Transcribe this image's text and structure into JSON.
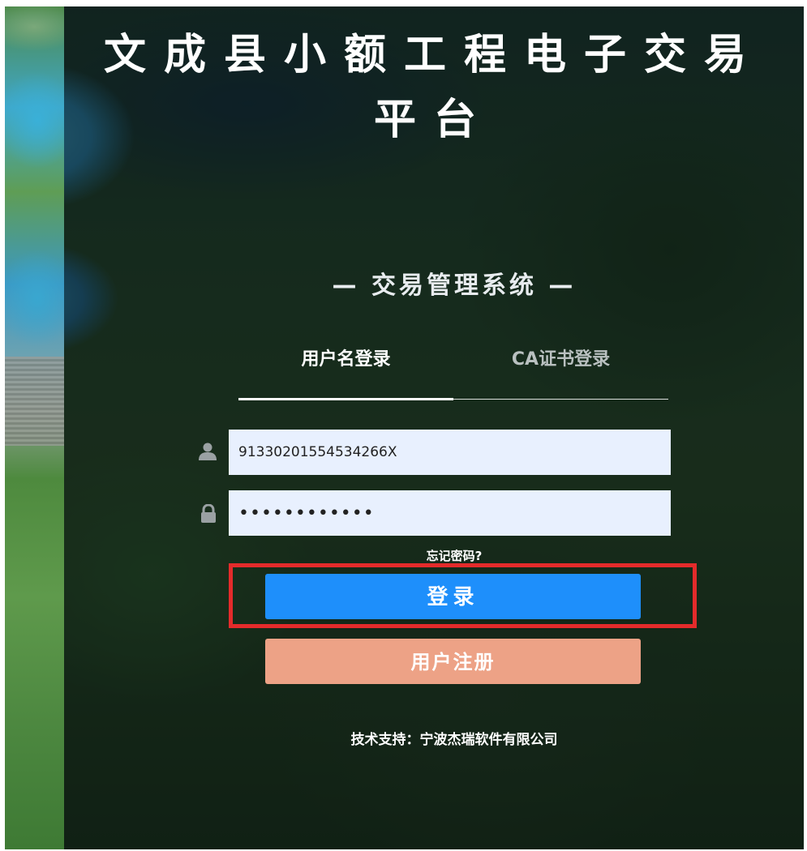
{
  "header": {
    "title_line1": "文成县小额工程电子交易",
    "title_line2": "平台"
  },
  "login_panel": {
    "system_name": "— 交易管理系统 —",
    "tabs": [
      {
        "label": "用户名登录",
        "active": true
      },
      {
        "label": "CA证书登录",
        "active": false
      }
    ],
    "username": {
      "value": "91330201554534266X",
      "icon": "user-icon"
    },
    "password": {
      "value": "••••••••••••",
      "icon": "lock-icon"
    },
    "forgot_label": "忘记密码?",
    "login_button": "登录",
    "register_button": "用户注册"
  },
  "footer": {
    "support": "技术支持：宁波杰瑞软件有限公司"
  },
  "colors": {
    "login_button": "#1e8ffb",
    "register_button": "#eda286",
    "highlight": "#e42b2b",
    "input_bg": "#e8f0fe"
  }
}
